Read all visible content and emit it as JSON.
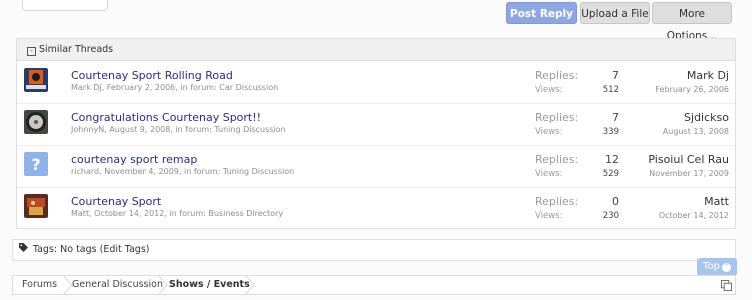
{
  "toolbar": {
    "post_reply_label": "Post Reply",
    "upload_label": "Upload a File",
    "more_options_label": "More Options..."
  },
  "similar_threads": {
    "header_toggle": "-",
    "header": "Similar Threads",
    "replies_label": "Replies:",
    "views_label": "Views:",
    "rows": [
      {
        "title": "Courtenay Sport Rolling Road",
        "meta": "Mark Dj, February 2, 2006, in forum: Car Discussion",
        "replies": "7",
        "views": "512",
        "last_user": "Mark Dj",
        "last_date": "February 26, 2006",
        "avatar_icon": "logo-avatar-icon"
      },
      {
        "title": "Congratulations Courtenay Sport!!",
        "meta": "JohnnyN, August 9, 2008, in forum: Tuning Discussion",
        "replies": "7",
        "views": "339",
        "last_user": "Sjdickso",
        "last_date": "August 13, 2008",
        "avatar_icon": "wheel-avatar-icon"
      },
      {
        "title": "courtenay sport remap",
        "meta": "richard, November 4, 2009, in forum: Tuning Discussion",
        "replies": "12",
        "views": "529",
        "last_user": "Pisoiul Cel Rau",
        "last_date": "November 17, 2009",
        "avatar_icon": "question-mark-avatar-icon"
      },
      {
        "title": "Courtenay Sport",
        "meta": "Matt, October 14, 2012, in forum: Business Directory",
        "replies": "0",
        "views": "230",
        "last_user": "Matt",
        "last_date": "October 14, 2012",
        "avatar_icon": "photo-avatar-icon"
      }
    ]
  },
  "tags": {
    "text": "Tags: No tags (Edit Tags)"
  },
  "top_button": {
    "label": "Top",
    "arrow": "^"
  },
  "breadcrumb": {
    "items": [
      "Forums",
      "General Discussion",
      "Shows / Events"
    ]
  },
  "colors": {
    "primary_button": "#8fa7e0",
    "thread_title": "#2c2c7a",
    "top_button": "#a8c4ec"
  }
}
